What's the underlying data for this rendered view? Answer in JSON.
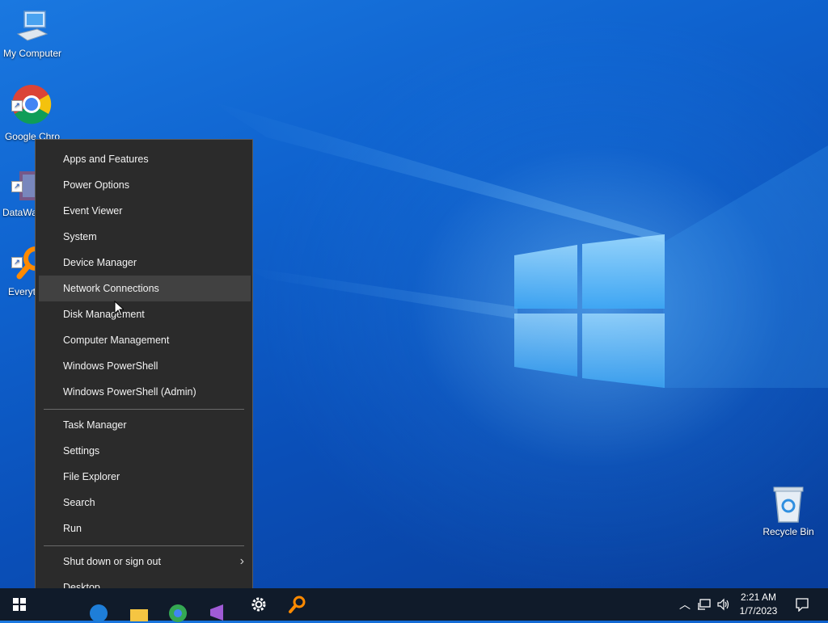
{
  "desktop": {
    "icons": [
      {
        "label": "My Computer",
        "icon": "computer-icon"
      },
      {
        "label": "Google Chro",
        "icon": "chrome-icon"
      },
      {
        "label": "DataWa",
        "icon": "datawarrior-icon"
      },
      {
        "label": "Everyt",
        "icon": "everything-search-icon"
      },
      {
        "label": "Recycle Bin",
        "icon": "recycle-bin-icon"
      }
    ]
  },
  "menu": {
    "group1": [
      {
        "label": "Apps and Features"
      },
      {
        "label": "Power Options"
      },
      {
        "label": "Event Viewer"
      },
      {
        "label": "System"
      },
      {
        "label": "Device Manager"
      },
      {
        "label": "Network Connections"
      },
      {
        "label": "Disk Management"
      },
      {
        "label": "Computer Management"
      },
      {
        "label": "Windows PowerShell"
      },
      {
        "label": "Windows PowerShell (Admin)"
      }
    ],
    "group2": [
      {
        "label": "Task Manager"
      },
      {
        "label": "Settings"
      },
      {
        "label": "File Explorer"
      },
      {
        "label": "Search"
      },
      {
        "label": "Run"
      }
    ],
    "group3": [
      {
        "label": "Shut down or sign out"
      },
      {
        "label": "Desktop"
      }
    ],
    "chevron": "›"
  },
  "taskbar": {
    "time": "2:21 AM",
    "date": "1/7/2023"
  },
  "colors": {
    "menu_bg": "#2b2b2b",
    "menu_hover": "#414141",
    "taskbar_bg": "#101b2a"
  }
}
